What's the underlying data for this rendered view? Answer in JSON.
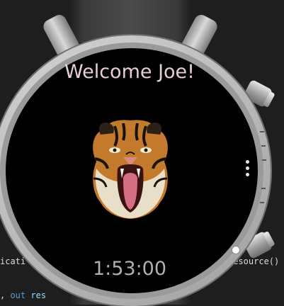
{
  "editor": {
    "line1_left": "icati",
    "line1_right": "Resource()",
    "line2_prefix": ", ",
    "line2_keyword": "out",
    "line2_rest": " res"
  },
  "watch": {
    "greeting": "Welcome Joe!",
    "time": "1:53:00",
    "image_icon": "tiger-face-image",
    "menu_icon": "more-vertical-icon"
  },
  "colors": {
    "greeting": "#e8cdd6",
    "time": "#b0b0b0",
    "face": "#000000",
    "bezel": "#bdbdbd"
  }
}
